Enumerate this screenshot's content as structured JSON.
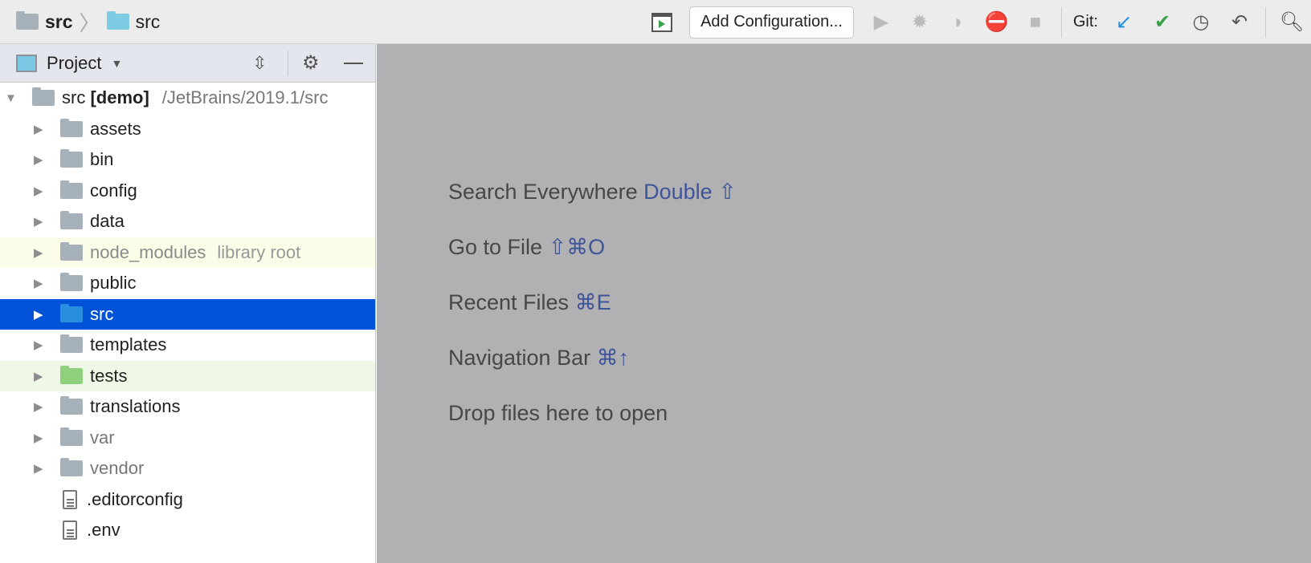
{
  "breadcrumb": [
    "src",
    "src"
  ],
  "toolbar": {
    "add_config": "Add Configuration...",
    "git_label": "Git:"
  },
  "panel": {
    "title": "Project"
  },
  "tree": {
    "root": {
      "name": "src",
      "module": "[demo]",
      "path": "/JetBrains/2019.1/src"
    },
    "folders": [
      {
        "name": "assets"
      },
      {
        "name": "bin"
      },
      {
        "name": "config"
      },
      {
        "name": "data"
      },
      {
        "name": "node_modules",
        "note": "library root"
      },
      {
        "name": "public"
      },
      {
        "name": "src"
      },
      {
        "name": "templates"
      },
      {
        "name": "tests"
      },
      {
        "name": "translations"
      },
      {
        "name": "var"
      },
      {
        "name": "vendor"
      }
    ],
    "files": [
      ".editorconfig",
      ".env"
    ]
  },
  "editor": {
    "hints": [
      {
        "text": "Search Everywhere",
        "key": "Double ⇧"
      },
      {
        "text": "Go to File",
        "key": "⇧⌘O"
      },
      {
        "text": "Recent Files",
        "key": "⌘E"
      },
      {
        "text": "Navigation Bar",
        "key": "⌘↑"
      },
      {
        "text": "Drop files here to open",
        "key": ""
      }
    ]
  }
}
